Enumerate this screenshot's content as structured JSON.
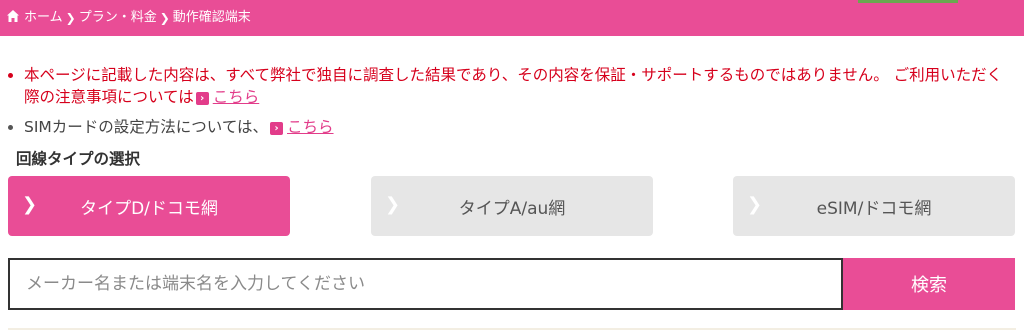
{
  "colors": {
    "brand": "#e94d96",
    "link": "#e23c8a",
    "notice": "#d6001c",
    "inactive": "#e6e6e6"
  },
  "breadcrumb": {
    "home_icon": "home-icon",
    "items": [
      "ホーム",
      "プラン・料金",
      "動作確認端末"
    ]
  },
  "notes": {
    "disclaimer_text": "本ページに記載した内容は、すべて弊社で独自に調査した結果であり、その内容を保証・サポートするものではありません。 ご利用いただく際の注意事項については",
    "disclaimer_link": "こちら",
    "sim_text": "SIMカードの設定方法については、",
    "sim_link": "こちら"
  },
  "line_type": {
    "title": "回線タイプの選択",
    "options": [
      {
        "label": "タイプD/ドコモ網",
        "selected": true
      },
      {
        "label": "タイプA/au網",
        "selected": false
      },
      {
        "label": "eSIM/ドコモ網",
        "selected": false
      }
    ]
  },
  "search": {
    "value": "",
    "placeholder": "メーカー名または端末名を入力してください",
    "button_label": "検索"
  }
}
